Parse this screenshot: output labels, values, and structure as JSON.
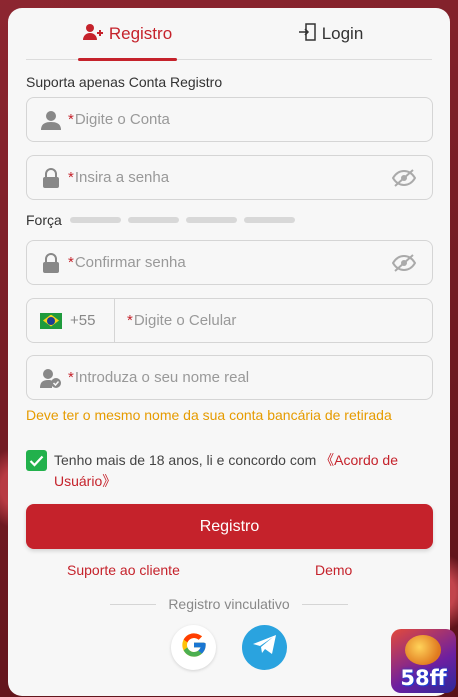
{
  "tabs": {
    "register_label": "Registro",
    "login_label": "Login"
  },
  "form": {
    "support_hint": "Suporta apenas Conta Registro",
    "account_placeholder": "Digite o Conta",
    "password_placeholder": "Insira a senha",
    "strength_label": "Força",
    "confirm_placeholder": "Confirmar senha",
    "country_code": "+55",
    "phone_placeholder": "Digite o Celular",
    "realname_placeholder": "Introduza o seu nome real",
    "realname_warning": "Deve ter o mesmo nome da sua conta bancária de retirada",
    "required_mark": "*"
  },
  "agreement": {
    "checked": true,
    "text": "Tenho mais de 18 anos, li e concordo com ",
    "link": "《Acordo de Usuário》"
  },
  "submit_label": "Registro",
  "links": {
    "support": "Suporte ao cliente",
    "demo": "Demo"
  },
  "social": {
    "divider": "Registro vinculativo",
    "icons": [
      "google-icon",
      "telegram-icon"
    ]
  },
  "brand": {
    "logo_text": "58ff"
  },
  "colors": {
    "accent": "#c5222b",
    "warning": "#e69b00",
    "checkbox": "#22b14c"
  }
}
